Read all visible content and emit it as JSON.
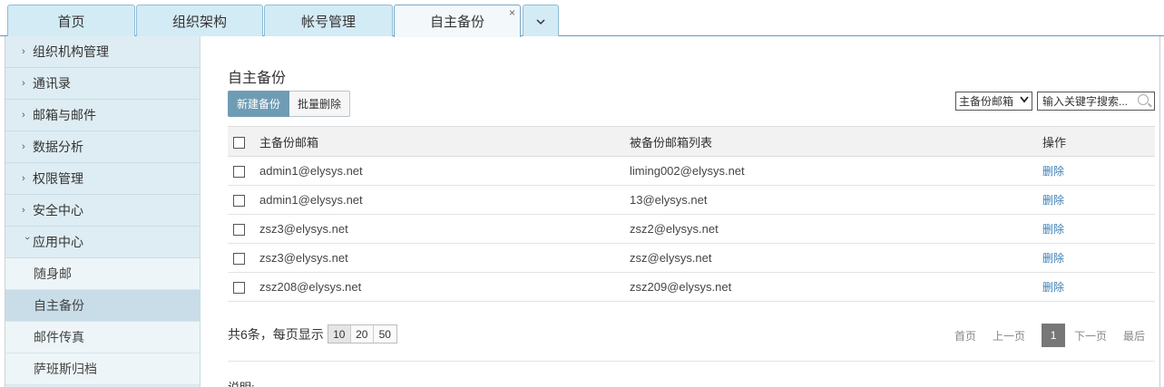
{
  "tabs": [
    "首页",
    "组织架构",
    "帐号管理",
    "自主备份"
  ],
  "sidebar": {
    "items": [
      "组织机构管理",
      "通讯录",
      "邮箱与邮件",
      "数据分析",
      "权限管理",
      "安全中心",
      "应用中心"
    ],
    "subitems": [
      "随身邮",
      "自主备份",
      "邮件传真",
      "萨班斯归档"
    ]
  },
  "main": {
    "title": "自主备份",
    "new_button": "新建备份",
    "batch_delete_button": "批量删除",
    "filter_select": "主备份邮箱",
    "search_placeholder": "输入关键字搜索...",
    "note_label": "说明:"
  },
  "table": {
    "headers": [
      "主备份邮箱",
      "被备份邮箱列表",
      "操作"
    ],
    "rows": [
      {
        "primary": "admin1@elysys.net",
        "backup": "liming002@elysys.net",
        "action": "删除"
      },
      {
        "primary": "admin1@elysys.net",
        "backup": "13@elysys.net",
        "action": "删除"
      },
      {
        "primary": "zsz3@elysys.net",
        "backup": "zsz2@elysys.net",
        "action": "删除"
      },
      {
        "primary": "zsz3@elysys.net",
        "backup": "zsz@elysys.net",
        "action": "删除"
      },
      {
        "primary": "zsz208@elysys.net",
        "backup": "zsz209@elysys.net",
        "action": "删除"
      }
    ]
  },
  "pagination": {
    "summary": "共6条，每页显示",
    "sizes": [
      "10",
      "20",
      "50"
    ],
    "first": "首页",
    "prev": "上一页",
    "current": "1",
    "next": "下一页",
    "last": "最后"
  },
  "colors": {
    "accent": "#6f9cb5",
    "tab_background": "#d3ebf5",
    "sidebar_background": "#deedf3",
    "link": "#3f7fb5"
  }
}
